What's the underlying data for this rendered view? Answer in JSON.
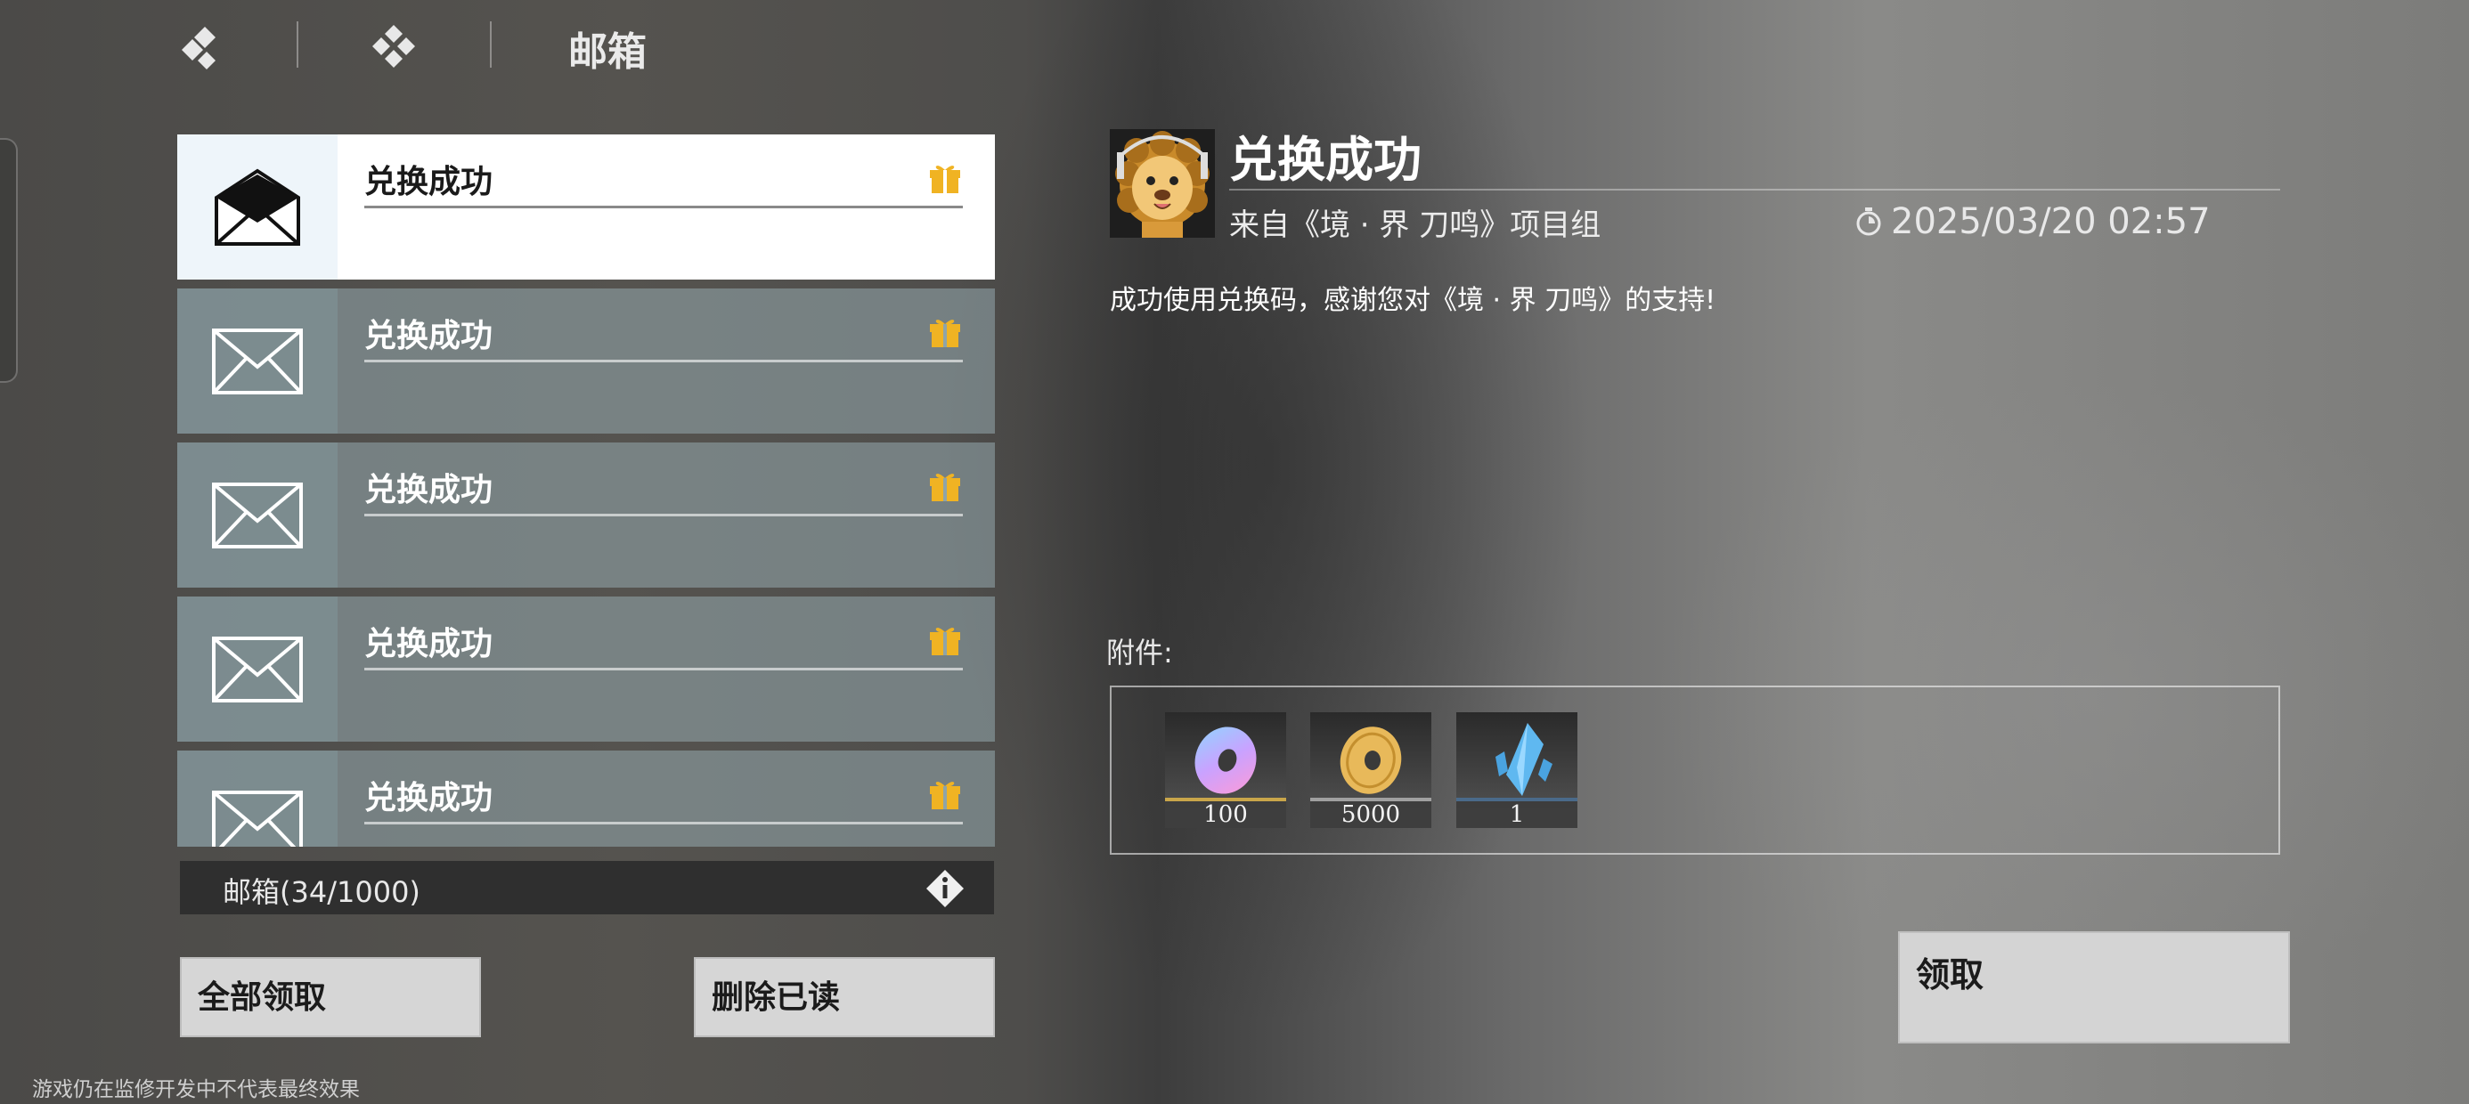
{
  "header": {
    "title": "邮箱",
    "back_icon": "back-diamond-icon",
    "home_icon": "home-diamond-icon"
  },
  "mail_list": {
    "items": [
      {
        "title": "兑换成功",
        "state": "selected",
        "icon": "envelope-open-icon",
        "badge": "gift-icon"
      },
      {
        "title": "兑换成功",
        "state": "unread",
        "icon": "envelope-icon",
        "badge": "gift-icon"
      },
      {
        "title": "兑换成功",
        "state": "unread",
        "icon": "envelope-icon",
        "badge": "gift-icon"
      },
      {
        "title": "兑换成功",
        "state": "unread",
        "icon": "envelope-icon",
        "badge": "gift-icon"
      },
      {
        "title": "兑换成功",
        "state": "unread",
        "icon": "envelope-icon",
        "badge": "gift-icon"
      }
    ],
    "count_text": "邮箱(34/1000)"
  },
  "actions": {
    "claim_all": "全部领取",
    "delete_read": "删除已读",
    "claim": "领取"
  },
  "detail": {
    "title": "兑换成功",
    "sender": "来自《境 · 界 刀鸣》项目组",
    "time": "2025/03/20 02:57",
    "body": "成功使用兑换码，感谢您对《境 · 界 刀鸣》的支持!",
    "attachments_label": "附件:",
    "attachments": [
      {
        "name": "purple-ring-item-icon",
        "qty": "100"
      },
      {
        "name": "gold-coin-item-icon",
        "qty": "5000"
      },
      {
        "name": "blue-crystal-item-icon",
        "qty": "1"
      }
    ]
  },
  "footer": {
    "note": "游戏仍在监修开发中不代表最终效果"
  },
  "colors": {
    "gift": "#f0b323",
    "selected_bg": "#ffffff",
    "unread_bg": "#8fa4a8",
    "button_bg": "#d6d6d6"
  }
}
